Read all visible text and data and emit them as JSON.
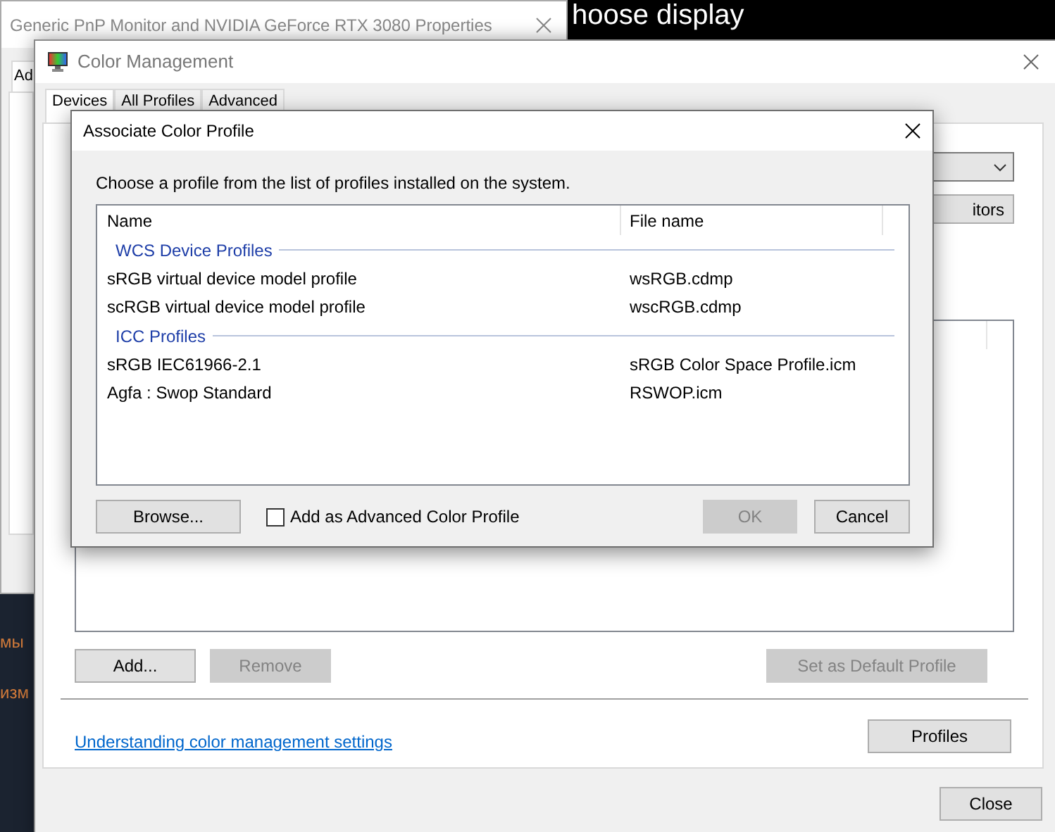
{
  "background": {
    "heading": "hoose display",
    "side_texts": [
      "мы",
      "изм"
    ]
  },
  "properties_window": {
    "title": "Generic PnP Monitor and NVIDIA GeForce RTX 3080 Properties",
    "tabs": [
      {
        "label": "Ad",
        "selected": true
      }
    ]
  },
  "color_management": {
    "title": "Color Management",
    "tabs": [
      {
        "label": "Devices",
        "selected": true
      },
      {
        "label": "All Profiles",
        "selected": false
      },
      {
        "label": "Advanced",
        "selected": false
      }
    ],
    "identify_button": "itors",
    "profile_buttons": [
      {
        "label": "Add...",
        "disabled": false
      },
      {
        "label": "Remove",
        "disabled": true
      },
      {
        "label": "Set as Default Profile",
        "disabled": true
      }
    ],
    "link": "Understanding color management settings",
    "profiles_button": "Profiles",
    "close_button": "Close"
  },
  "dialog": {
    "title": "Associate Color Profile",
    "instruction": "Choose a profile from the list of profiles installed on the system.",
    "columns": [
      "Name",
      "File name"
    ],
    "groups": [
      {
        "name": "WCS Device Profiles",
        "rows": [
          {
            "name": "sRGB virtual device model profile",
            "file": "wsRGB.cdmp"
          },
          {
            "name": "scRGB virtual device model profile",
            "file": "wscRGB.cdmp"
          }
        ]
      },
      {
        "name": "ICC Profiles",
        "rows": [
          {
            "name": "sRGB IEC61966-2.1",
            "file": "sRGB Color Space Profile.icm"
          },
          {
            "name": "Agfa : Swop Standard",
            "file": "RSWOP.icm"
          }
        ]
      }
    ],
    "browse_button": "Browse...",
    "advanced_checkbox": {
      "label": "Add as Advanced Color Profile",
      "checked": false
    },
    "buttons": [
      {
        "label": "OK",
        "disabled": true
      },
      {
        "label": "Cancel",
        "disabled": false
      }
    ]
  }
}
